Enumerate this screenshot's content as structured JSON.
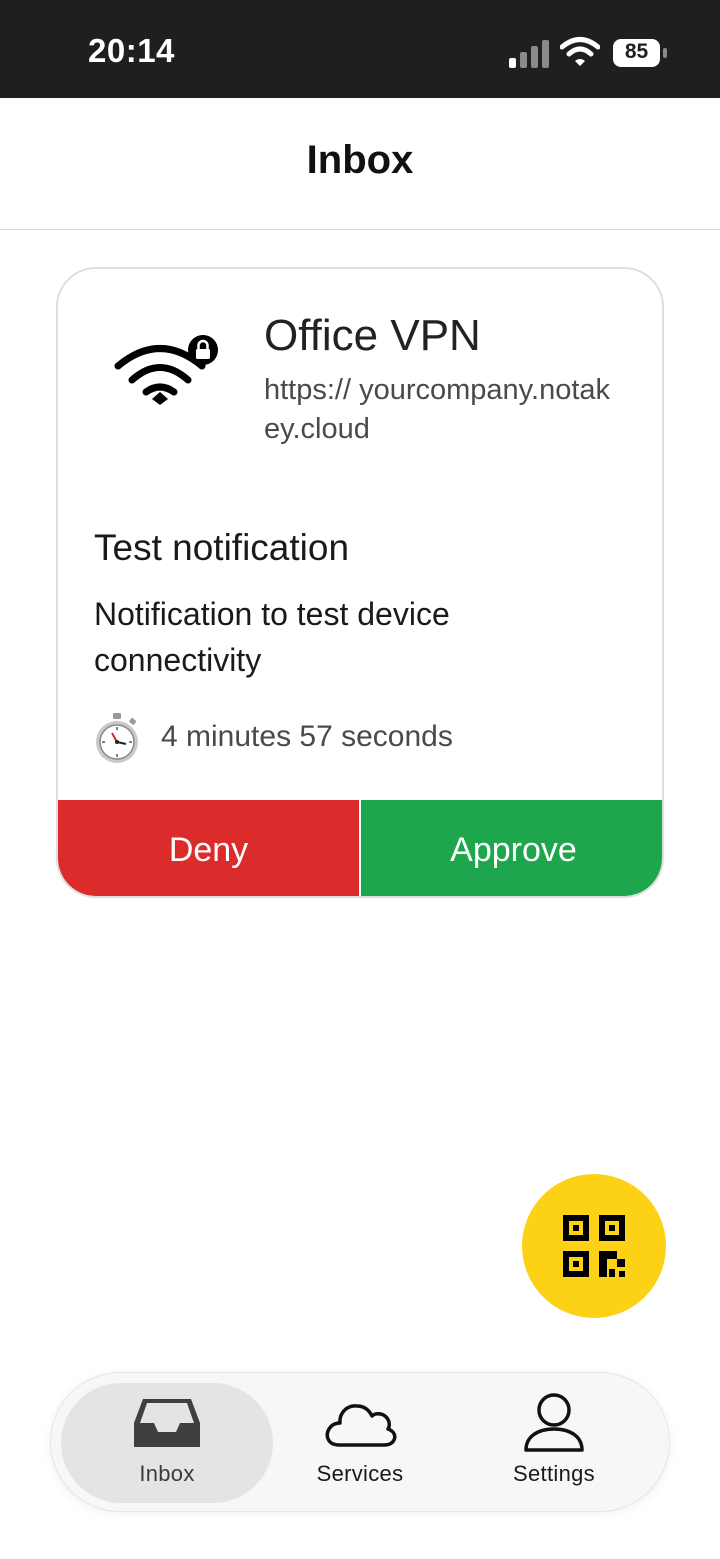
{
  "status_bar": {
    "time": "20:14",
    "battery": "85",
    "signal_icon": "cellular-signal-icon",
    "wifi_icon": "wifi-icon",
    "battery_icon": "battery-icon"
  },
  "header": {
    "title": "Inbox"
  },
  "request": {
    "service_icon": "wifi-lock-icon",
    "service_name": "Office VPN",
    "service_url": "https://\nyourcompany.notakey.cloud",
    "title": "Test notification",
    "message": "Notification to test device connectivity",
    "timer_icon": "stopwatch-icon",
    "expires_in": "4 minutes 57 seconds",
    "deny_label": "Deny",
    "approve_label": "Approve",
    "colors": {
      "deny": "#dc2b2b",
      "approve": "#1ea64c"
    }
  },
  "fab": {
    "icon": "qr-code-icon",
    "color": "#fcd116"
  },
  "tab_bar": {
    "tabs": [
      {
        "label": "Inbox",
        "icon": "inbox-tray-icon",
        "selected": true
      },
      {
        "label": "Services",
        "icon": "cloud-icon",
        "selected": false
      },
      {
        "label": "Settings",
        "icon": "person-icon",
        "selected": false
      }
    ]
  }
}
